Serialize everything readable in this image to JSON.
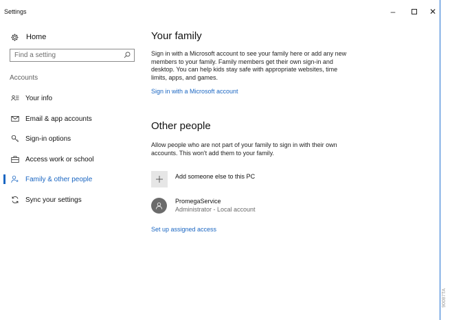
{
  "window": {
    "title": "Settings",
    "minimize_glyph": "–",
    "close_glyph": "✕"
  },
  "sidebar": {
    "home_label": "Home",
    "search_placeholder": "Find a setting",
    "section_label": "Accounts",
    "items": [
      {
        "label": "Your info",
        "icon": "person-list-icon",
        "active": false
      },
      {
        "label": "Email & app accounts",
        "icon": "envelope-icon",
        "active": false
      },
      {
        "label": "Sign-in options",
        "icon": "key-icon",
        "active": false
      },
      {
        "label": "Access work or school",
        "icon": "briefcase-icon",
        "active": false
      },
      {
        "label": "Family & other people",
        "icon": "people-icon",
        "active": true
      },
      {
        "label": "Sync your settings",
        "icon": "sync-icon",
        "active": false
      }
    ]
  },
  "main": {
    "family": {
      "title": "Your family",
      "description": "Sign in with a Microsoft account to see your family here or add any new members to your family. Family members get their own sign-in and desktop. You can help kids stay safe with appropriate websites, time limits, apps, and games.",
      "link": "Sign in with a Microsoft account"
    },
    "other": {
      "title": "Other people",
      "description": "Allow people who are not part of your family to sign in with their own accounts. This won't add them to your family.",
      "add_label": "Add someone else to this PC",
      "account_name": "PromegaService",
      "account_sub": "Administrator - Local account",
      "assigned_link": "Set up assigned access"
    }
  },
  "watermark": "90087TA",
  "colors": {
    "accent": "#1a66c2",
    "tile": "#e6e6e6",
    "avatar": "#6b6b6b",
    "window_border": "#1f6fd1"
  }
}
